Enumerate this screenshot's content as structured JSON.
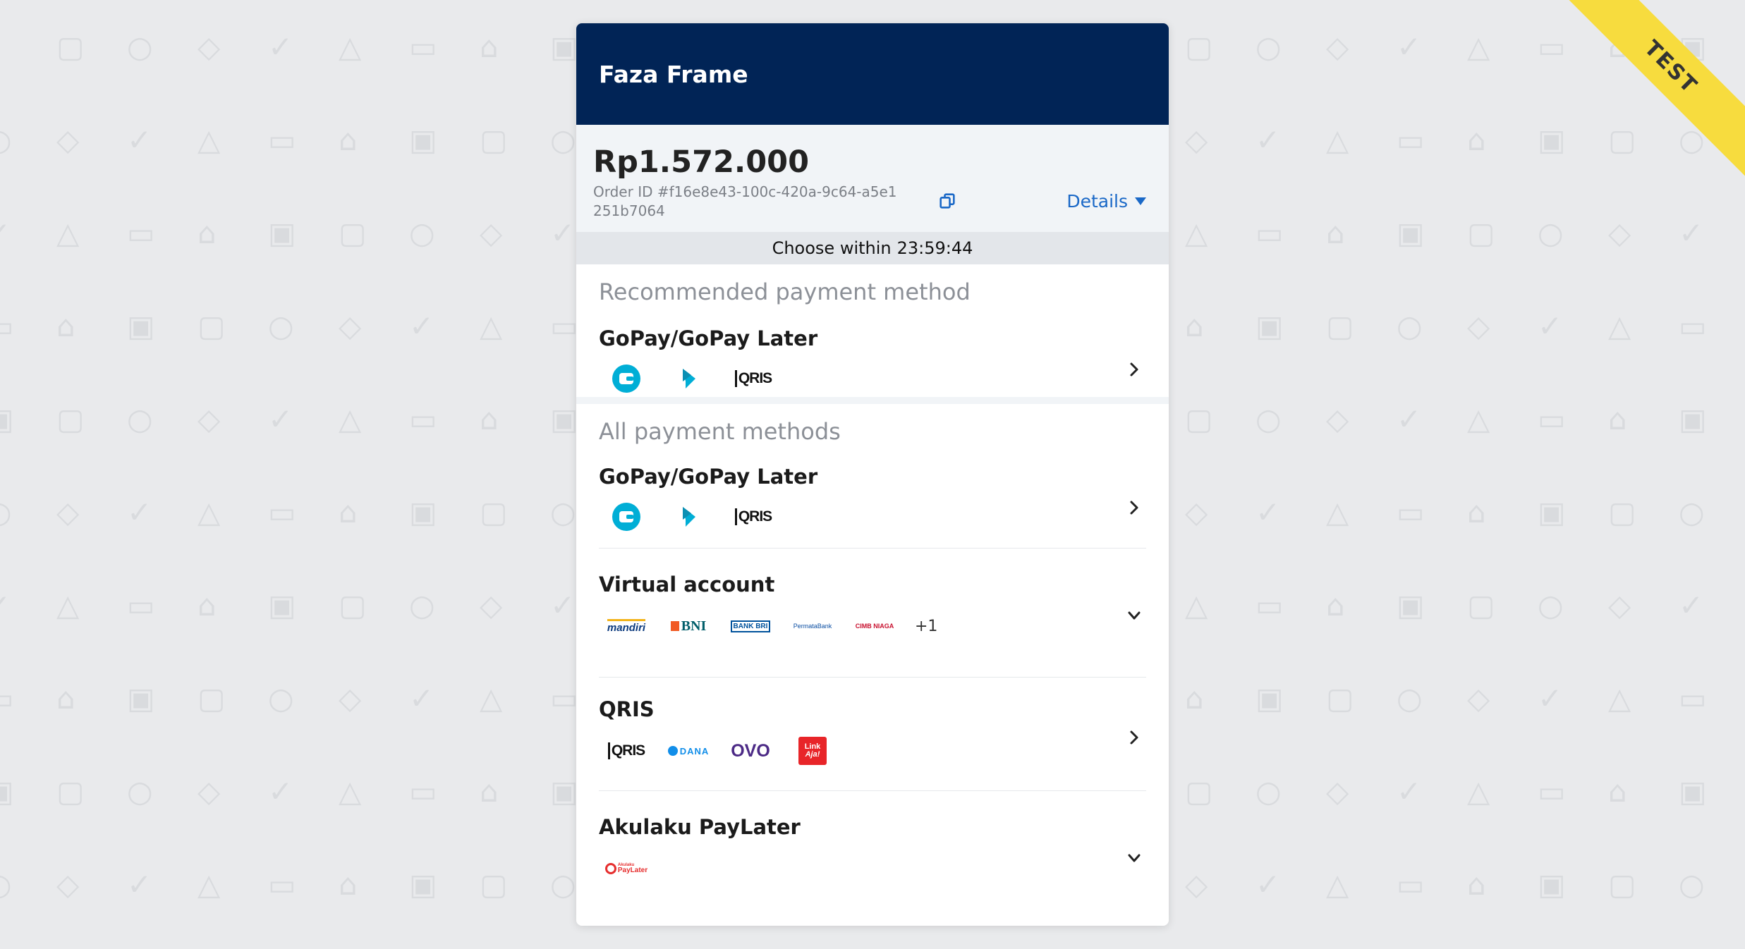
{
  "ribbon": "TEST",
  "merchant": {
    "name": "Faza Frame"
  },
  "summary": {
    "amount": "Rp1.572.000",
    "order_id": "Order ID #f16e8e43-100c-420a-9c64-a5e1251b7064",
    "details_label": "Details"
  },
  "timer": {
    "label": "Choose within",
    "value": "23:59:44"
  },
  "recommended": {
    "title": "Recommended payment method",
    "method": {
      "name": "GoPay/GoPay Later",
      "logos": [
        "gopay-wallet-icon",
        "gopay-later-icon",
        "qris-logo"
      ]
    }
  },
  "all_methods": {
    "title": "All payment methods",
    "items": [
      {
        "name": "GoPay/GoPay Later",
        "logos": [
          "gopay-wallet-icon",
          "gopay-later-icon",
          "qris-logo"
        ],
        "chevron": "chevron-right-icon"
      },
      {
        "name": "Virtual account",
        "logos": [
          "mandiri-logo",
          "bni-logo",
          "bri-logo",
          "permata-logo",
          "cimb-logo"
        ],
        "more": "+1",
        "chevron": "chevron-down-icon"
      },
      {
        "name": "QRIS",
        "logos": [
          "qris-logo",
          "dana-logo",
          "ovo-logo",
          "linkaja-logo"
        ],
        "chevron": "chevron-right-icon"
      },
      {
        "name": "Akulaku PayLater",
        "logos": [
          "akulaku-logo"
        ],
        "chevron": "chevron-down-icon"
      }
    ]
  },
  "logo_text": {
    "qris": "QRIS",
    "mandiri": "mandiri",
    "bni": "BNI",
    "bri": "BANK BRI",
    "permata": "PermataBank",
    "cimb": "CIMB NIAGA",
    "dana": "DANA",
    "ovo": "OVO",
    "linkaja_1": "Link",
    "linkaja_2": "Aja!",
    "akulaku_1": "Akulaku",
    "akulaku_2": "PayLater"
  },
  "colors": {
    "header_bg": "#012456",
    "accent": "#1a68c7",
    "gopay": "#00aed6",
    "ribbon": "#f7dc3e"
  }
}
